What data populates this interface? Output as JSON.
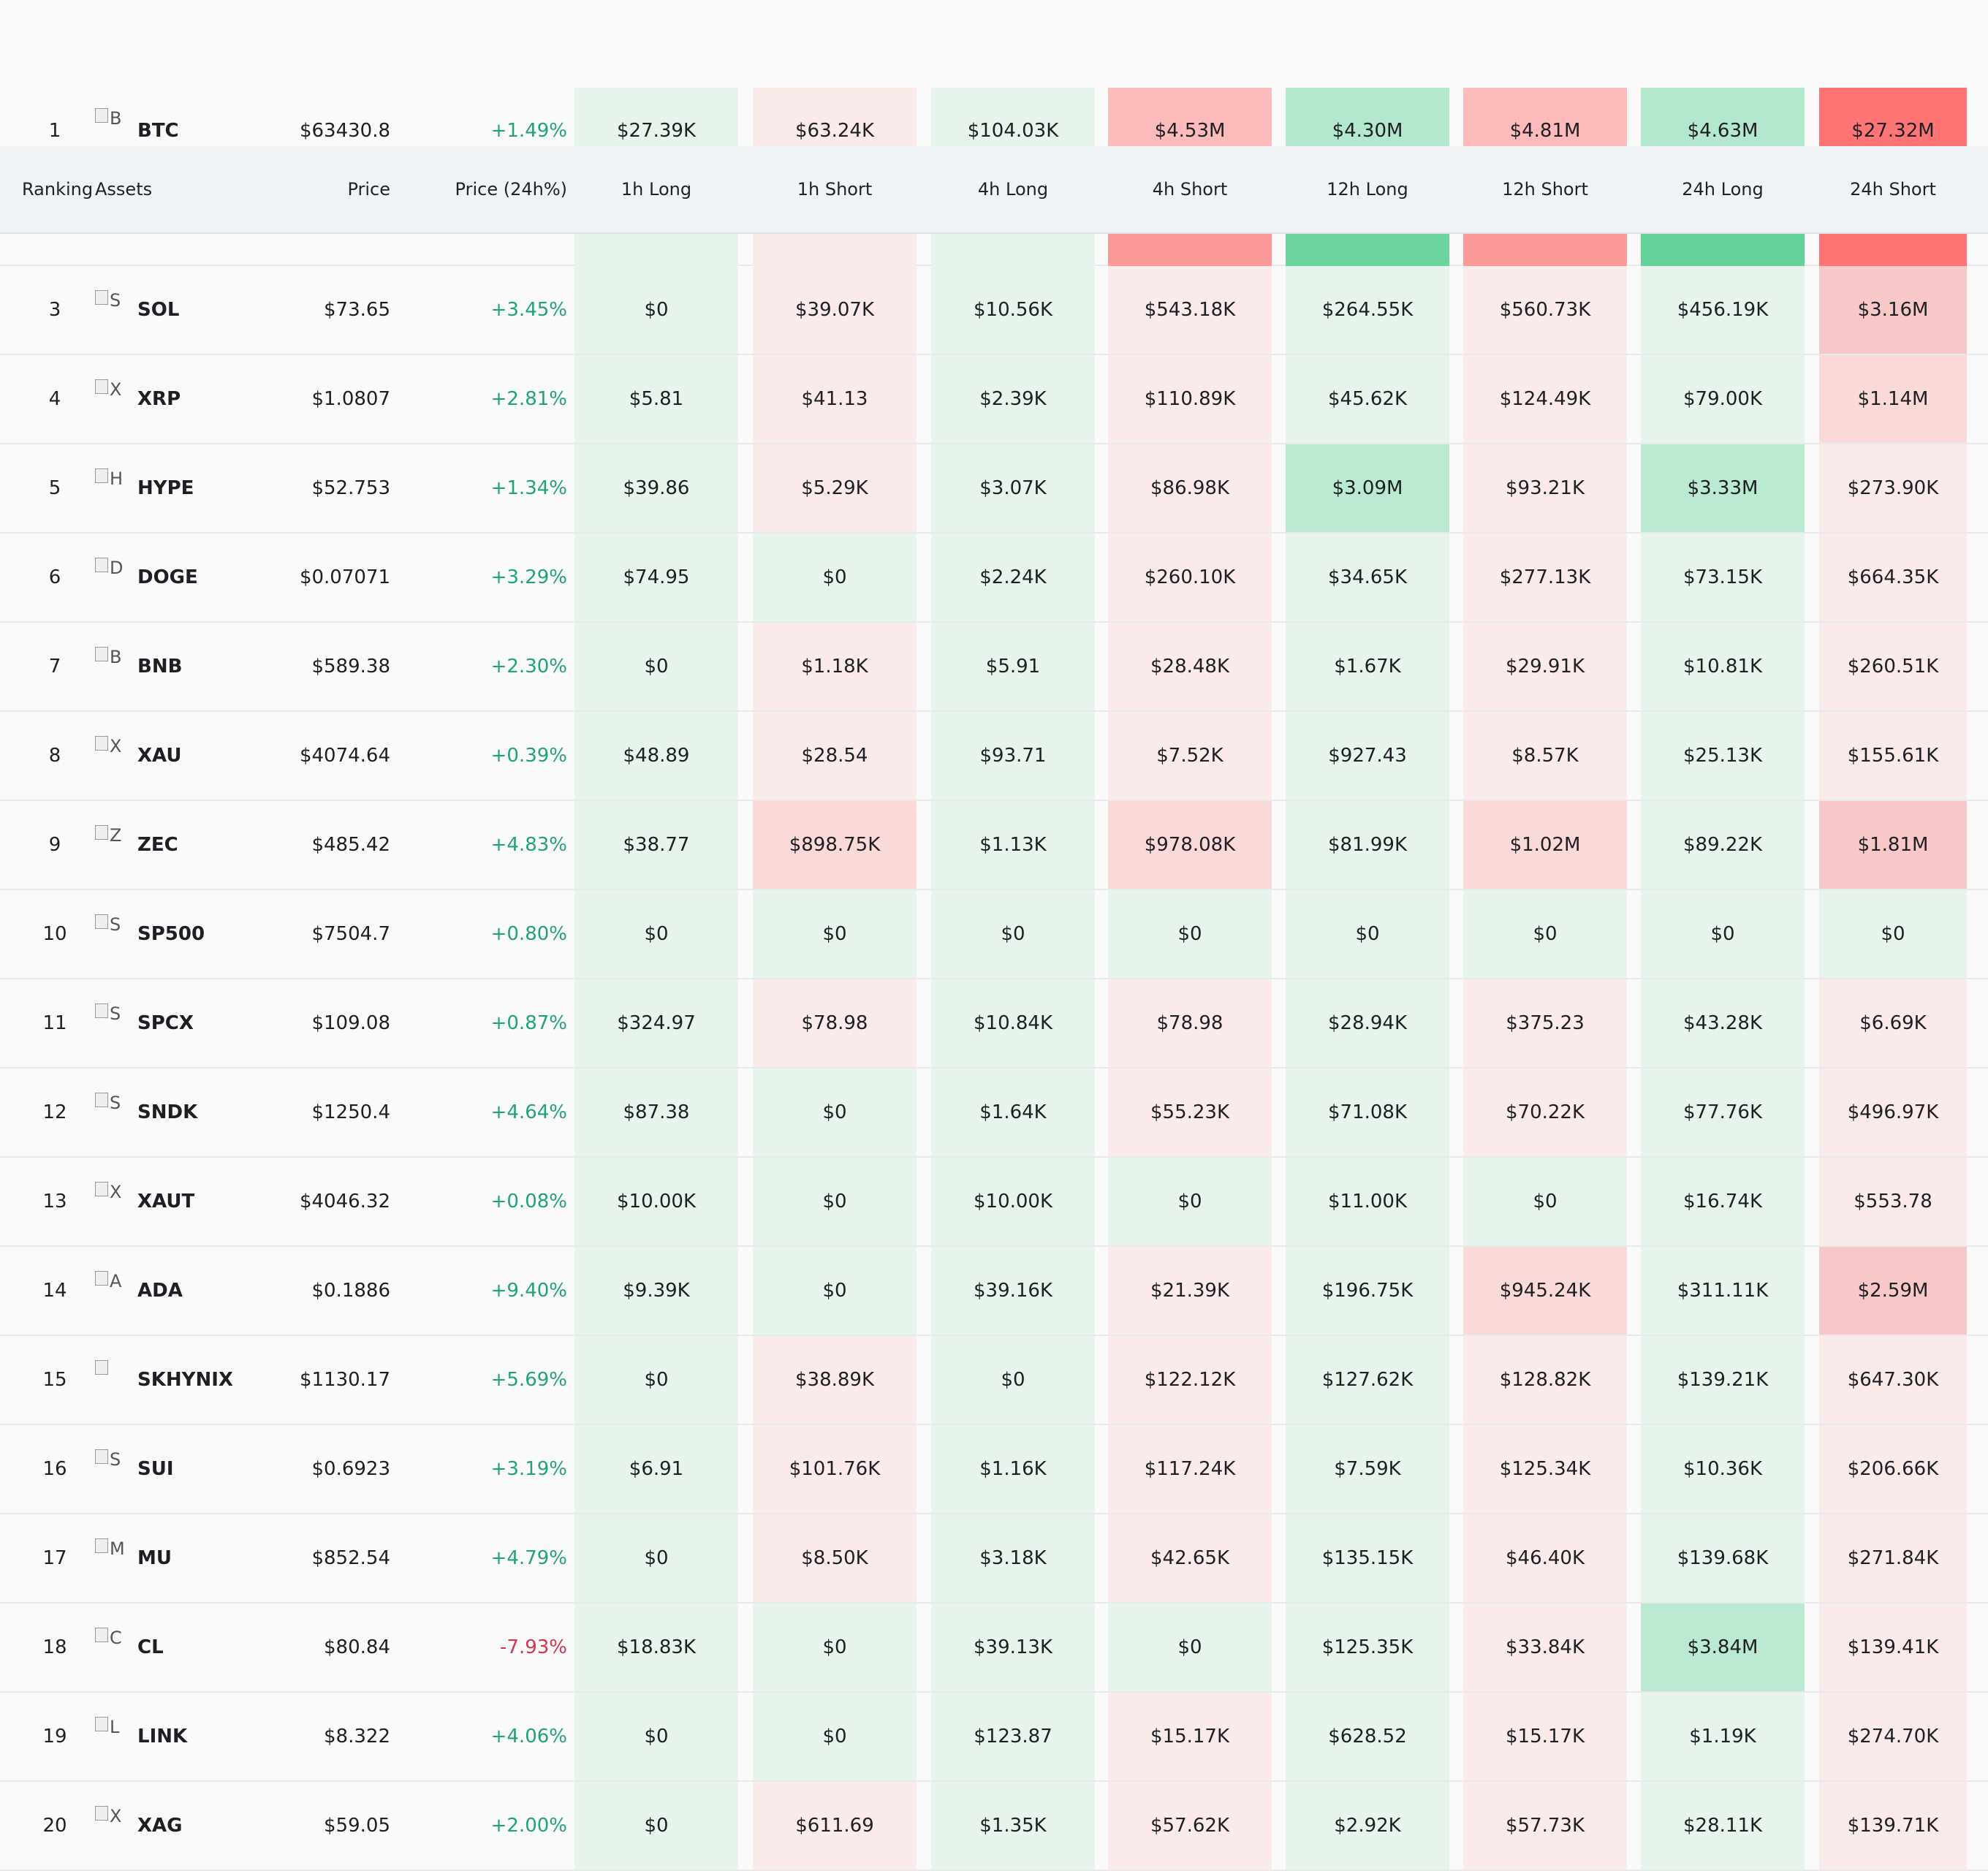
{
  "header": {
    "ranking": "Ranking",
    "assets": "Assets",
    "price": "Price",
    "change": "Price (24h%)",
    "cols": [
      "1h Long",
      "1h Short",
      "4h Long",
      "4h Short",
      "12h Long",
      "12h Short",
      "24h Long",
      "24h Short"
    ]
  },
  "colors": {
    "long_light": "#e7f4ec",
    "short_light": "#faeaea",
    "long_mid": "#bbe9d2",
    "long_strong": "#b3e8ce",
    "short_mid": "#fad9d9",
    "short_strong": "#f8c8c8",
    "long_bar": "#6ed59e",
    "short_bar": "#ff7575",
    "positive": "#21a27a",
    "negative": "#d5344a"
  },
  "rows": [
    {
      "rank": "1",
      "icon": "B",
      "asset": "BTC",
      "price": "$63430.8",
      "change": "+1.49%",
      "values": [
        "$27.39K",
        "$63.24K",
        "$104.03K",
        "$4.53M",
        "$4.30M",
        "$4.81M",
        "$4.63M",
        "$27.32M"
      ]
    },
    {
      "rank": "3",
      "icon": "S",
      "asset": "SOL",
      "price": "$73.65",
      "change": "+3.45%",
      "values": [
        "$0",
        "$39.07K",
        "$10.56K",
        "$543.18K",
        "$264.55K",
        "$560.73K",
        "$456.19K",
        "$3.16M"
      ]
    },
    {
      "rank": "4",
      "icon": "X",
      "asset": "XRP",
      "price": "$1.0807",
      "change": "+2.81%",
      "values": [
        "$5.81",
        "$41.13",
        "$2.39K",
        "$110.89K",
        "$45.62K",
        "$124.49K",
        "$79.00K",
        "$1.14M"
      ]
    },
    {
      "rank": "5",
      "icon": "H",
      "asset": "HYPE",
      "price": "$52.753",
      "change": "+1.34%",
      "values": [
        "$39.86",
        "$5.29K",
        "$3.07K",
        "$86.98K",
        "$3.09M",
        "$93.21K",
        "$3.33M",
        "$273.90K"
      ]
    },
    {
      "rank": "6",
      "icon": "D",
      "asset": "DOGE",
      "price": "$0.07071",
      "change": "+3.29%",
      "values": [
        "$74.95",
        "$0",
        "$2.24K",
        "$260.10K",
        "$34.65K",
        "$277.13K",
        "$73.15K",
        "$664.35K"
      ]
    },
    {
      "rank": "7",
      "icon": "B",
      "asset": "BNB",
      "price": "$589.38",
      "change": "+2.30%",
      "values": [
        "$0",
        "$1.18K",
        "$5.91",
        "$28.48K",
        "$1.67K",
        "$29.91K",
        "$10.81K",
        "$260.51K"
      ]
    },
    {
      "rank": "8",
      "icon": "X",
      "asset": "XAU",
      "price": "$4074.64",
      "change": "+0.39%",
      "values": [
        "$48.89",
        "$28.54",
        "$93.71",
        "$7.52K",
        "$927.43",
        "$8.57K",
        "$25.13K",
        "$155.61K"
      ]
    },
    {
      "rank": "9",
      "icon": "Z",
      "asset": "ZEC",
      "price": "$485.42",
      "change": "+4.83%",
      "values": [
        "$38.77",
        "$898.75K",
        "$1.13K",
        "$978.08K",
        "$81.99K",
        "$1.02M",
        "$89.22K",
        "$1.81M"
      ]
    },
    {
      "rank": "10",
      "icon": "S",
      "asset": "SP500",
      "price": "$7504.7",
      "change": "+0.80%",
      "values": [
        "$0",
        "$0",
        "$0",
        "$0",
        "$0",
        "$0",
        "$0",
        "$0"
      ]
    },
    {
      "rank": "11",
      "icon": "S",
      "asset": "SPCX",
      "price": "$109.08",
      "change": "+0.87%",
      "values": [
        "$324.97",
        "$78.98",
        "$10.84K",
        "$78.98",
        "$28.94K",
        "$375.23",
        "$43.28K",
        "$6.69K"
      ]
    },
    {
      "rank": "12",
      "icon": "S",
      "asset": "SNDK",
      "price": "$1250.4",
      "change": "+4.64%",
      "values": [
        "$87.38",
        "$0",
        "$1.64K",
        "$55.23K",
        "$71.08K",
        "$70.22K",
        "$77.76K",
        "$496.97K"
      ]
    },
    {
      "rank": "13",
      "icon": "X",
      "asset": "XAUT",
      "price": "$4046.32",
      "change": "+0.08%",
      "values": [
        "$10.00K",
        "$0",
        "$10.00K",
        "$0",
        "$11.00K",
        "$0",
        "$16.74K",
        "$553.78"
      ]
    },
    {
      "rank": "14",
      "icon": "A",
      "asset": "ADA",
      "price": "$0.1886",
      "change": "+9.40%",
      "values": [
        "$9.39K",
        "$0",
        "$39.16K",
        "$21.39K",
        "$196.75K",
        "$945.24K",
        "$311.11K",
        "$2.59M"
      ]
    },
    {
      "rank": "15",
      "icon": "",
      "asset": "SKHYNIX",
      "price": "$1130.17",
      "change": "+5.69%",
      "values": [
        "$0",
        "$38.89K",
        "$0",
        "$122.12K",
        "$127.62K",
        "$128.82K",
        "$139.21K",
        "$647.30K"
      ]
    },
    {
      "rank": "16",
      "icon": "S",
      "asset": "SUI",
      "price": "$0.6923",
      "change": "+3.19%",
      "values": [
        "$6.91",
        "$101.76K",
        "$1.16K",
        "$117.24K",
        "$7.59K",
        "$125.34K",
        "$10.36K",
        "$206.66K"
      ]
    },
    {
      "rank": "17",
      "icon": "M",
      "asset": "MU",
      "price": "$852.54",
      "change": "+4.79%",
      "values": [
        "$0",
        "$8.50K",
        "$3.18K",
        "$42.65K",
        "$135.15K",
        "$46.40K",
        "$139.68K",
        "$271.84K"
      ]
    },
    {
      "rank": "18",
      "icon": "C",
      "asset": "CL",
      "price": "$80.84",
      "change": "-7.93%",
      "values": [
        "$18.83K",
        "$0",
        "$39.13K",
        "$0",
        "$125.35K",
        "$33.84K",
        "$3.84M",
        "$139.41K"
      ]
    },
    {
      "rank": "19",
      "icon": "L",
      "asset": "LINK",
      "price": "$8.322",
      "change": "+4.06%",
      "values": [
        "$0",
        "$0",
        "$123.87",
        "$15.17K",
        "$628.52",
        "$15.17K",
        "$1.19K",
        "$274.70K"
      ]
    },
    {
      "rank": "20",
      "icon": "X",
      "asset": "XAG",
      "price": "$59.05",
      "change": "+2.00%",
      "values": [
        "$0",
        "$611.69",
        "$1.35K",
        "$57.62K",
        "$2.92K",
        "$57.73K",
        "$28.11K",
        "$139.71K"
      ]
    }
  ]
}
